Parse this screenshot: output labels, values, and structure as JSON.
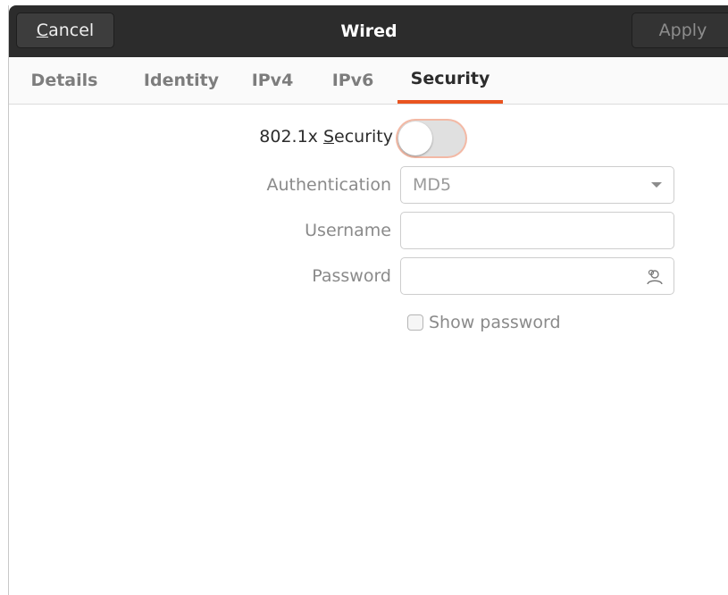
{
  "header": {
    "title": "Wired",
    "cancel_mnemonic": "C",
    "cancel_rest": "ancel",
    "apply_label": "Apply"
  },
  "tabs": [
    {
      "label": "Details"
    },
    {
      "label": "Identity"
    },
    {
      "label": "IPv4"
    },
    {
      "label": "IPv6"
    },
    {
      "label": "Security",
      "active": true
    }
  ],
  "security": {
    "toggle_label_prefix": "802.1x ",
    "toggle_label_mnemonic": "S",
    "toggle_label_rest": "ecurity",
    "enabled": false,
    "authentication_label": "Authentication",
    "authentication_value": "MD5",
    "username_label": "Username",
    "username_value": "",
    "password_label": "Password",
    "password_value": "",
    "password_icon": "user-icon",
    "show_password_label": "Show password",
    "show_password_checked": false
  },
  "colors": {
    "accent": "#e95420",
    "headerbar": "#2c2c2c"
  }
}
